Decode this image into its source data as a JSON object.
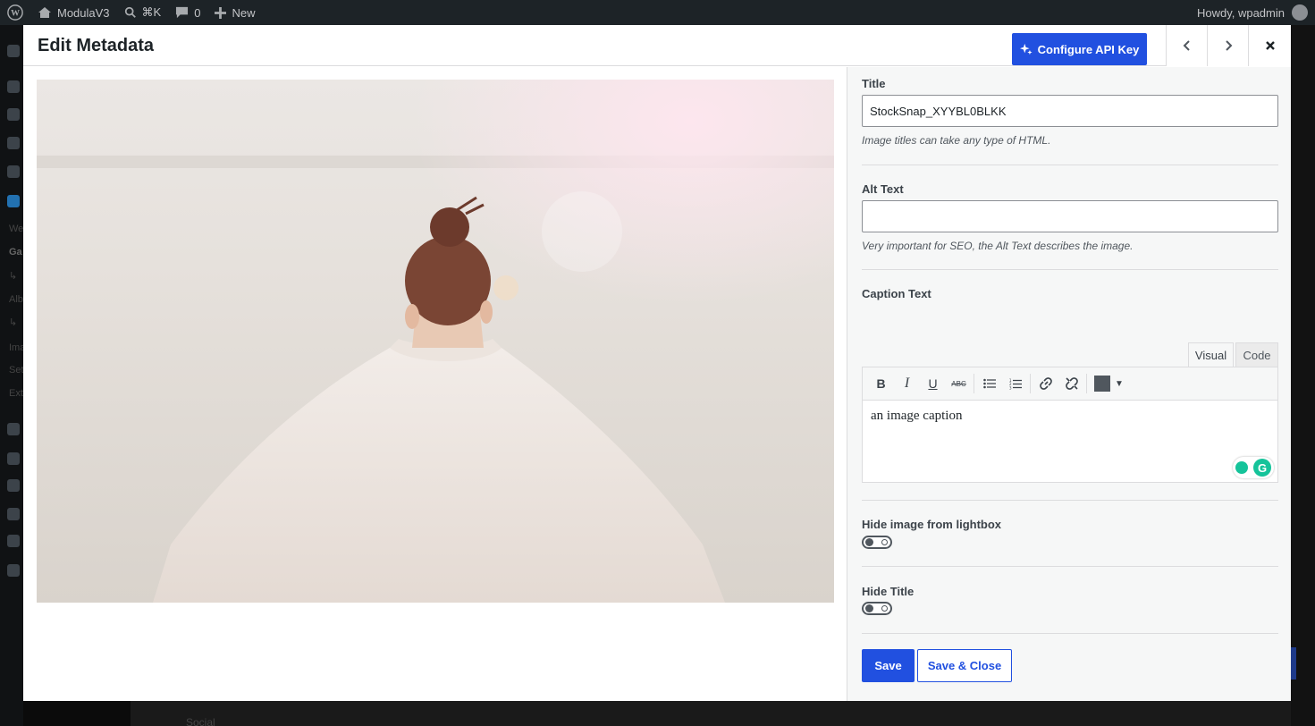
{
  "adminbar": {
    "site_name": "ModulaV3",
    "search_shortcut": "⌘K",
    "comments_count": "0",
    "new_label": "New",
    "greeting": "Howdy, wpadmin"
  },
  "background": {
    "menu_fragments": [
      "We",
      "Ga",
      "↳",
      "Alb",
      "↳",
      "Ima",
      "Set",
      "Ext"
    ],
    "footer_text": "Social"
  },
  "modal": {
    "title": "Edit Metadata",
    "api_key_button": "Configure API Key",
    "accent_color": "#2150e0"
  },
  "fields": {
    "title_label": "Title",
    "title_value": "StockSnap_XYYBL0BLKK",
    "title_help": "Image titles can take any type of HTML.",
    "alt_label": "Alt Text",
    "alt_value": "",
    "alt_help": "Very important for SEO, the Alt Text describes the image.",
    "caption_label": "Caption Text",
    "caption_value": "an image caption",
    "editor_tabs": [
      "Visual",
      "Code"
    ],
    "hide_lightbox_label": "Hide image from lightbox",
    "hide_lightbox_on": false,
    "hide_title_label": "Hide Title",
    "hide_title_on": false
  },
  "toolbar": {
    "bold": "B",
    "italic": "I",
    "underline": "U",
    "strike": "ABC",
    "icons": [
      "bold-icon",
      "italic-icon",
      "underline-icon",
      "strikethrough-icon",
      "bullet-list-icon",
      "numbered-list-icon",
      "link-icon",
      "unlink-icon",
      "text-color-icon"
    ]
  },
  "actions": {
    "save": "Save",
    "save_close": "Save & Close"
  }
}
